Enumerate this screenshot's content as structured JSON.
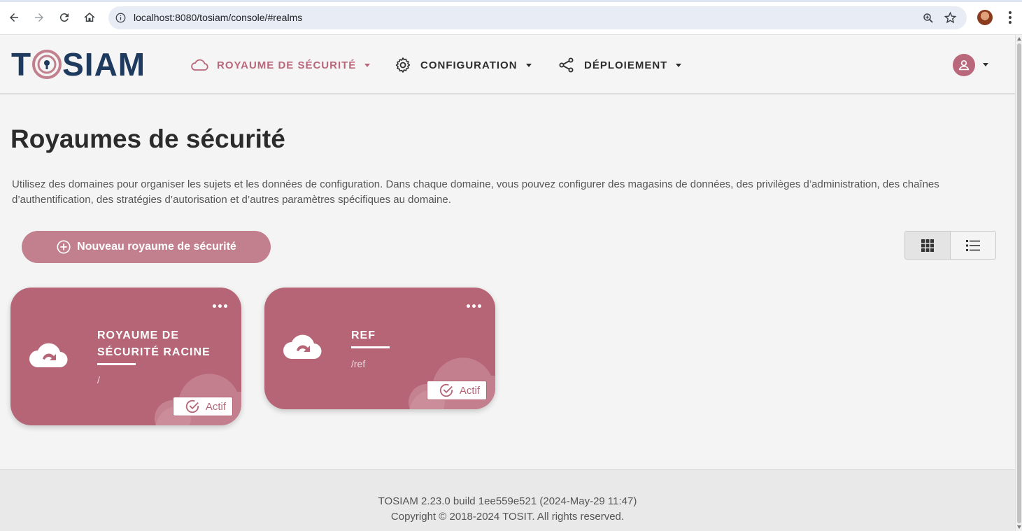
{
  "browser": {
    "url": "localhost:8080/tosiam/console/#realms"
  },
  "header": {
    "logo_text_left": "T",
    "logo_text_right": "SIAM",
    "menu": [
      {
        "label": "ROYAUME DE SÉCURITÉ",
        "icon": "cloud-icon",
        "active": true
      },
      {
        "label": "CONFIGURATION",
        "icon": "gear-icon",
        "active": false
      },
      {
        "label": "DÉPLOIEMENT",
        "icon": "share-icon",
        "active": false
      }
    ]
  },
  "main": {
    "title": "Royaumes de sécurité",
    "description": "Utilisez des domaines pour organiser les sujets et les données de configuration. Dans chaque domaine, vous pouvez configurer des magasins de données, des privilèges d’administration, des chaînes d’authentification, des stratégies d’autorisation et d’autres paramètres spécifiques au domaine.",
    "new_button_label": "Nouveau royaume de sécurité",
    "view_modes": [
      "grid",
      "list"
    ],
    "active_view": "grid"
  },
  "realms": [
    {
      "title_line1": "ROYAUME DE",
      "title_line2": "SÉCURITÉ RACINE",
      "path": "/",
      "status": "Actif"
    },
    {
      "title_line1": "REF",
      "title_line2": "",
      "path": "/ref",
      "status": "Actif"
    }
  ],
  "footer": {
    "version_line": "TOSIAM 2.23.0 build 1ee559e521 (2024-May-29 11:47)",
    "copyright": "Copyright © 2018-2024 TOSIT. All rights reserved."
  },
  "colors": {
    "accent": "#b56576",
    "button": "#c27f8d",
    "logo": "#1e3a5f"
  }
}
